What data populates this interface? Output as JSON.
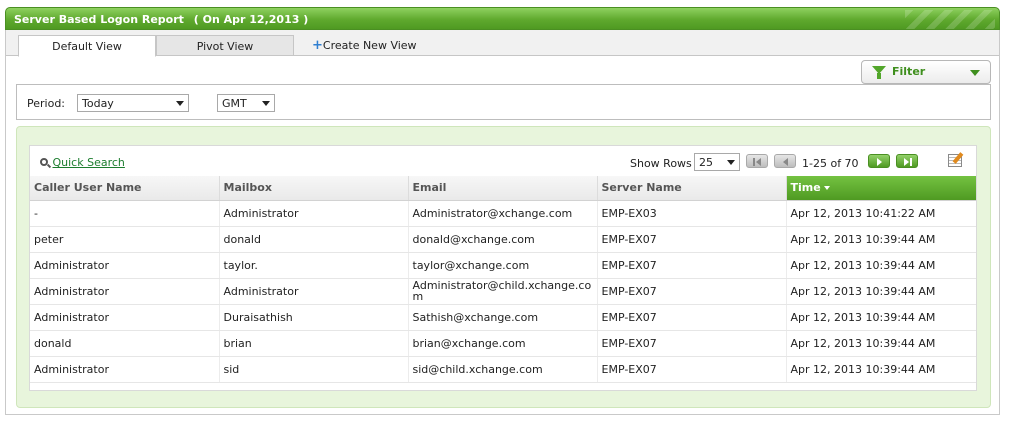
{
  "report": {
    "title": "Server Based Logon Report",
    "subtitle": "( On Apr 12,2013 )"
  },
  "tabs": [
    {
      "label": "Default View"
    },
    {
      "label": "Pivot View"
    },
    {
      "label": "Create New View"
    }
  ],
  "filter": {
    "label": "Filter"
  },
  "period": {
    "label": "Period:",
    "value": "Today",
    "timezone": "GMT"
  },
  "grid": {
    "quick_search": "Quick Search",
    "show_rows_label": "Show Rows",
    "rows_per_page": "25",
    "page_info": "1-25 of 70",
    "columns": [
      "Caller User Name",
      "Mailbox",
      "Email",
      "Server Name",
      "Time"
    ],
    "sorted_column": "Time",
    "rows": [
      {
        "caller": "-",
        "mailbox": "Administrator",
        "email": "Administrator@xchange.com",
        "server": "EMP-EX03",
        "time": "Apr 12, 2013 10:41:22 AM"
      },
      {
        "caller": "peter",
        "mailbox": "donald",
        "email": "donald@xchange.com",
        "server": "EMP-EX07",
        "time": "Apr 12, 2013 10:39:44 AM"
      },
      {
        "caller": "Administrator",
        "mailbox": "taylor.",
        "email": "taylor@xchange.com",
        "server": "EMP-EX07",
        "time": "Apr 12, 2013 10:39:44 AM"
      },
      {
        "caller": "Administrator",
        "mailbox": "Administrator",
        "email": "Administrator@child.xchange.com",
        "server": "EMP-EX07",
        "time": "Apr 12, 2013 10:39:44 AM"
      },
      {
        "caller": "Administrator",
        "mailbox": "Duraisathish",
        "email": "Sathish@xchange.com",
        "server": "EMP-EX07",
        "time": "Apr 12, 2013 10:39:44 AM"
      },
      {
        "caller": "donald",
        "mailbox": "brian",
        "email": "brian@xchange.com",
        "server": "EMP-EX07",
        "time": "Apr 12, 2013 10:39:44 AM"
      },
      {
        "caller": "Administrator",
        "mailbox": "sid",
        "email": "sid@child.xchange.com",
        "server": "EMP-EX07",
        "time": "Apr 12, 2013 10:39:44 AM"
      }
    ]
  },
  "colors": {
    "accent_green": "#5fa92e",
    "link_green": "#1c7d2e",
    "panel_bg": "#e8f5dc"
  }
}
